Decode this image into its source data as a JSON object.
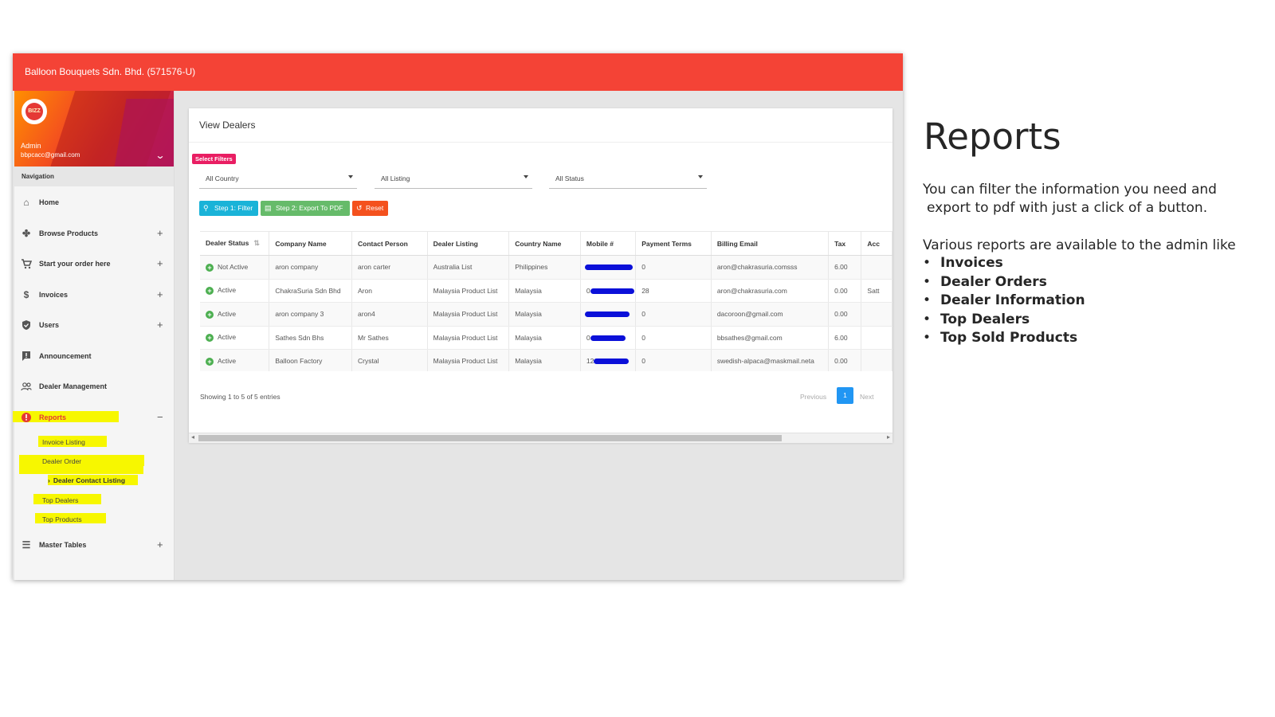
{
  "app": {
    "title": "Balloon Bouquets Sdn. Bhd. (571576-U)",
    "accent_color": "#f44336"
  },
  "sidebar": {
    "admin_name": "Admin",
    "admin_email": "bbpcacc@gmail.com",
    "navigation_label": "Navigation",
    "items": [
      {
        "label": "Home",
        "icon": "home-icon",
        "expand": ""
      },
      {
        "label": "Browse Products",
        "icon": "pinwheel-icon",
        "expand": "+"
      },
      {
        "label": "Start your order here",
        "icon": "cart-icon",
        "expand": "+"
      },
      {
        "label": "Invoices",
        "icon": "dollar-icon",
        "expand": "+"
      },
      {
        "label": "Users",
        "icon": "shield-icon",
        "expand": "+"
      },
      {
        "label": "Announcement",
        "icon": "feedback-icon",
        "expand": ""
      },
      {
        "label": "Dealer Management",
        "icon": "people-icon",
        "expand": ""
      },
      {
        "label": "Reports",
        "icon": "alert-icon",
        "expand": "−"
      },
      {
        "label": "Master Tables",
        "icon": "list-icon",
        "expand": "+"
      }
    ],
    "report_subitems": [
      "Invoice Listing",
      "Dealer Order",
      "Dealer Contact Listing",
      "Top Dealers",
      "Top Products"
    ]
  },
  "main": {
    "title": "View Dealers",
    "filter_badge": "Select Filters",
    "selects": [
      "All Country",
      "All Listing",
      "All Status"
    ],
    "buttons": {
      "filter": "Step 1: Filter",
      "export": "Step 2: Export To PDF",
      "reset": "Reset"
    },
    "table": {
      "columns": [
        "Dealer Status",
        "Company Name",
        "Contact Person",
        "Dealer Listing",
        "Country Name",
        "Mobile #",
        "Payment Terms",
        "Billing Email",
        "Tax",
        "Acc"
      ],
      "rows": [
        {
          "status": "Not Active",
          "company": "aron company",
          "contact": "aron carter",
          "listing": "Australia List",
          "country": "Philippines",
          "mobile": "",
          "terms": "0",
          "email": "aron@chakrasuria.comsss",
          "tax": "6.00",
          "acc": ""
        },
        {
          "status": "Active",
          "company": "ChakraSuria Sdn Bhd",
          "contact": "Aron",
          "listing": "Malaysia Product List",
          "country": "Malaysia",
          "mobile": "0",
          "terms": "28",
          "email": "aron@chakrasuria.com",
          "tax": "0.00",
          "acc": "Satt"
        },
        {
          "status": "Active",
          "company": "aron company 3",
          "contact": "aron4",
          "listing": "Malaysia Product List",
          "country": "Malaysia",
          "mobile": "",
          "terms": "0",
          "email": "dacoroon@gmail.com",
          "tax": "0.00",
          "acc": ""
        },
        {
          "status": "Active",
          "company": "Sathes Sdn Bhs",
          "contact": "Mr Sathes",
          "listing": "Malaysia Product List",
          "country": "Malaysia",
          "mobile": "0",
          "terms": "0",
          "email": "bbsathes@gmail.com",
          "tax": "6.00",
          "acc": ""
        },
        {
          "status": "Active",
          "company": "Balloon Factory",
          "contact": "Crystal",
          "listing": "Malaysia Product List",
          "country": "Malaysia",
          "mobile": "12",
          "terms": "0",
          "email": "swedish-alpaca@maskmail.neta",
          "tax": "0.00",
          "acc": ""
        }
      ]
    },
    "showing": "Showing 1 to 5 of 5 entries",
    "pager": {
      "prev": "Previous",
      "page": "1",
      "next": "Next"
    }
  },
  "slide": {
    "title": "Reports",
    "para1_line1": "You can filter the information you need and",
    "para1_line2": "export to pdf with just a click of a button.",
    "para2": "Various reports are available to the admin like",
    "bullets": [
      "Invoices",
      "Dealer Orders",
      "Dealer Information",
      "Top Dealers",
      "Top Sold Products"
    ]
  }
}
